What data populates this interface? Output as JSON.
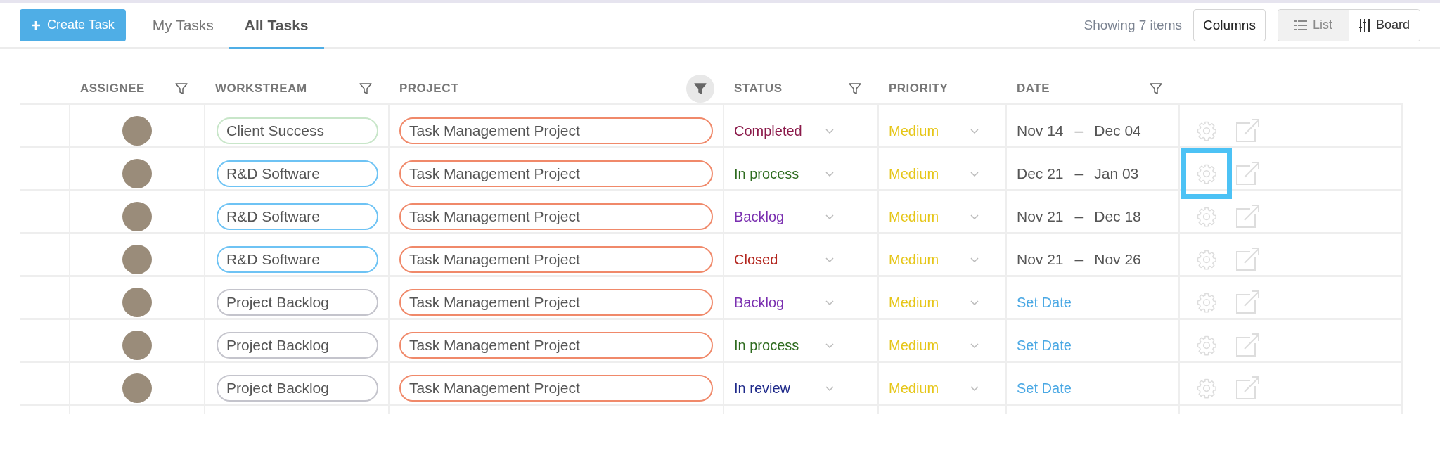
{
  "toolbar": {
    "create_button": "Create Task",
    "tabs": [
      {
        "label": "My Tasks",
        "selected": false
      },
      {
        "label": "All Tasks",
        "selected": true
      }
    ],
    "count": "Showing 7 items",
    "columns_button": "Columns",
    "views": [
      {
        "label": "List",
        "kind": "list",
        "selected": true
      },
      {
        "label": "Board",
        "kind": "board",
        "selected": false
      }
    ]
  },
  "table": {
    "columns": [
      {
        "label": "ASSIGNEE",
        "kind": "filterable",
        "filter_active": false
      },
      {
        "label": "WORKSTREAM",
        "kind": "filterable",
        "filter_active": false
      },
      {
        "label": "PROJECT",
        "kind": "filterable",
        "filter_active": true
      },
      {
        "label": "STATUS",
        "kind": "filterable",
        "filter_active": false
      },
      {
        "label": "PRIORITY",
        "kind": "plain"
      },
      {
        "label": "DATE",
        "kind": "filterable",
        "filter_active": false
      }
    ],
    "rows": [
      {
        "workstream": {
          "label": "Client Success",
          "color": "#c8e6c9"
        },
        "project": {
          "label": "Task Management Project",
          "color": "#f0896a"
        },
        "status": {
          "label": "Completed",
          "color": "#8b1a4a"
        },
        "priority": {
          "label": "Medium",
          "color": "#e6c619"
        },
        "date": {
          "kind": "range",
          "start": "Nov 14",
          "separator": "–",
          "end": "Dec 04"
        },
        "settings_highlighted": false
      },
      {
        "workstream": {
          "label": "R&D Software",
          "color": "#6ec3f4"
        },
        "project": {
          "label": "Task Management Project",
          "color": "#f0896a"
        },
        "status": {
          "label": "In process",
          "color": "#2e6b1f"
        },
        "priority": {
          "label": "Medium",
          "color": "#e6c619"
        },
        "date": {
          "kind": "range",
          "start": "Dec 21",
          "separator": "–",
          "end": "Jan 03"
        },
        "settings_highlighted": true
      },
      {
        "workstream": {
          "label": "R&D Software",
          "color": "#6ec3f4"
        },
        "project": {
          "label": "Task Management Project",
          "color": "#f0896a"
        },
        "status": {
          "label": "Backlog",
          "color": "#7a2fb0"
        },
        "priority": {
          "label": "Medium",
          "color": "#e6c619"
        },
        "date": {
          "kind": "range",
          "start": "Nov 21",
          "separator": "–",
          "end": "Dec 18"
        },
        "settings_highlighted": false
      },
      {
        "workstream": {
          "label": "R&D Software",
          "color": "#6ec3f4"
        },
        "project": {
          "label": "Task Management Project",
          "color": "#f0896a"
        },
        "status": {
          "label": "Closed",
          "color": "#b3261e"
        },
        "priority": {
          "label": "Medium",
          "color": "#e6c619"
        },
        "date": {
          "kind": "range",
          "start": "Nov 21",
          "separator": "–",
          "end": "Nov 26"
        },
        "settings_highlighted": false
      },
      {
        "workstream": {
          "label": "Project Backlog",
          "color": "#c4c4cc"
        },
        "project": {
          "label": "Task Management Project",
          "color": "#f0896a"
        },
        "status": {
          "label": "Backlog",
          "color": "#7a2fb0"
        },
        "priority": {
          "label": "Medium",
          "color": "#e6c619"
        },
        "date": {
          "kind": "link",
          "text": "Set Date"
        },
        "settings_highlighted": false
      },
      {
        "workstream": {
          "label": "Project Backlog",
          "color": "#c4c4cc"
        },
        "project": {
          "label": "Task Management Project",
          "color": "#f0896a"
        },
        "status": {
          "label": "In process",
          "color": "#2e6b1f"
        },
        "priority": {
          "label": "Medium",
          "color": "#e6c619"
        },
        "date": {
          "kind": "link",
          "text": "Set Date"
        },
        "settings_highlighted": false
      },
      {
        "workstream": {
          "label": "Project Backlog",
          "color": "#c4c4cc"
        },
        "project": {
          "label": "Task Management Project",
          "color": "#f0896a"
        },
        "status": {
          "label": "In review",
          "color": "#1f2a8a"
        },
        "priority": {
          "label": "Medium",
          "color": "#e6c619"
        },
        "date": {
          "kind": "link",
          "text": "Set Date"
        },
        "settings_highlighted": false
      }
    ]
  }
}
